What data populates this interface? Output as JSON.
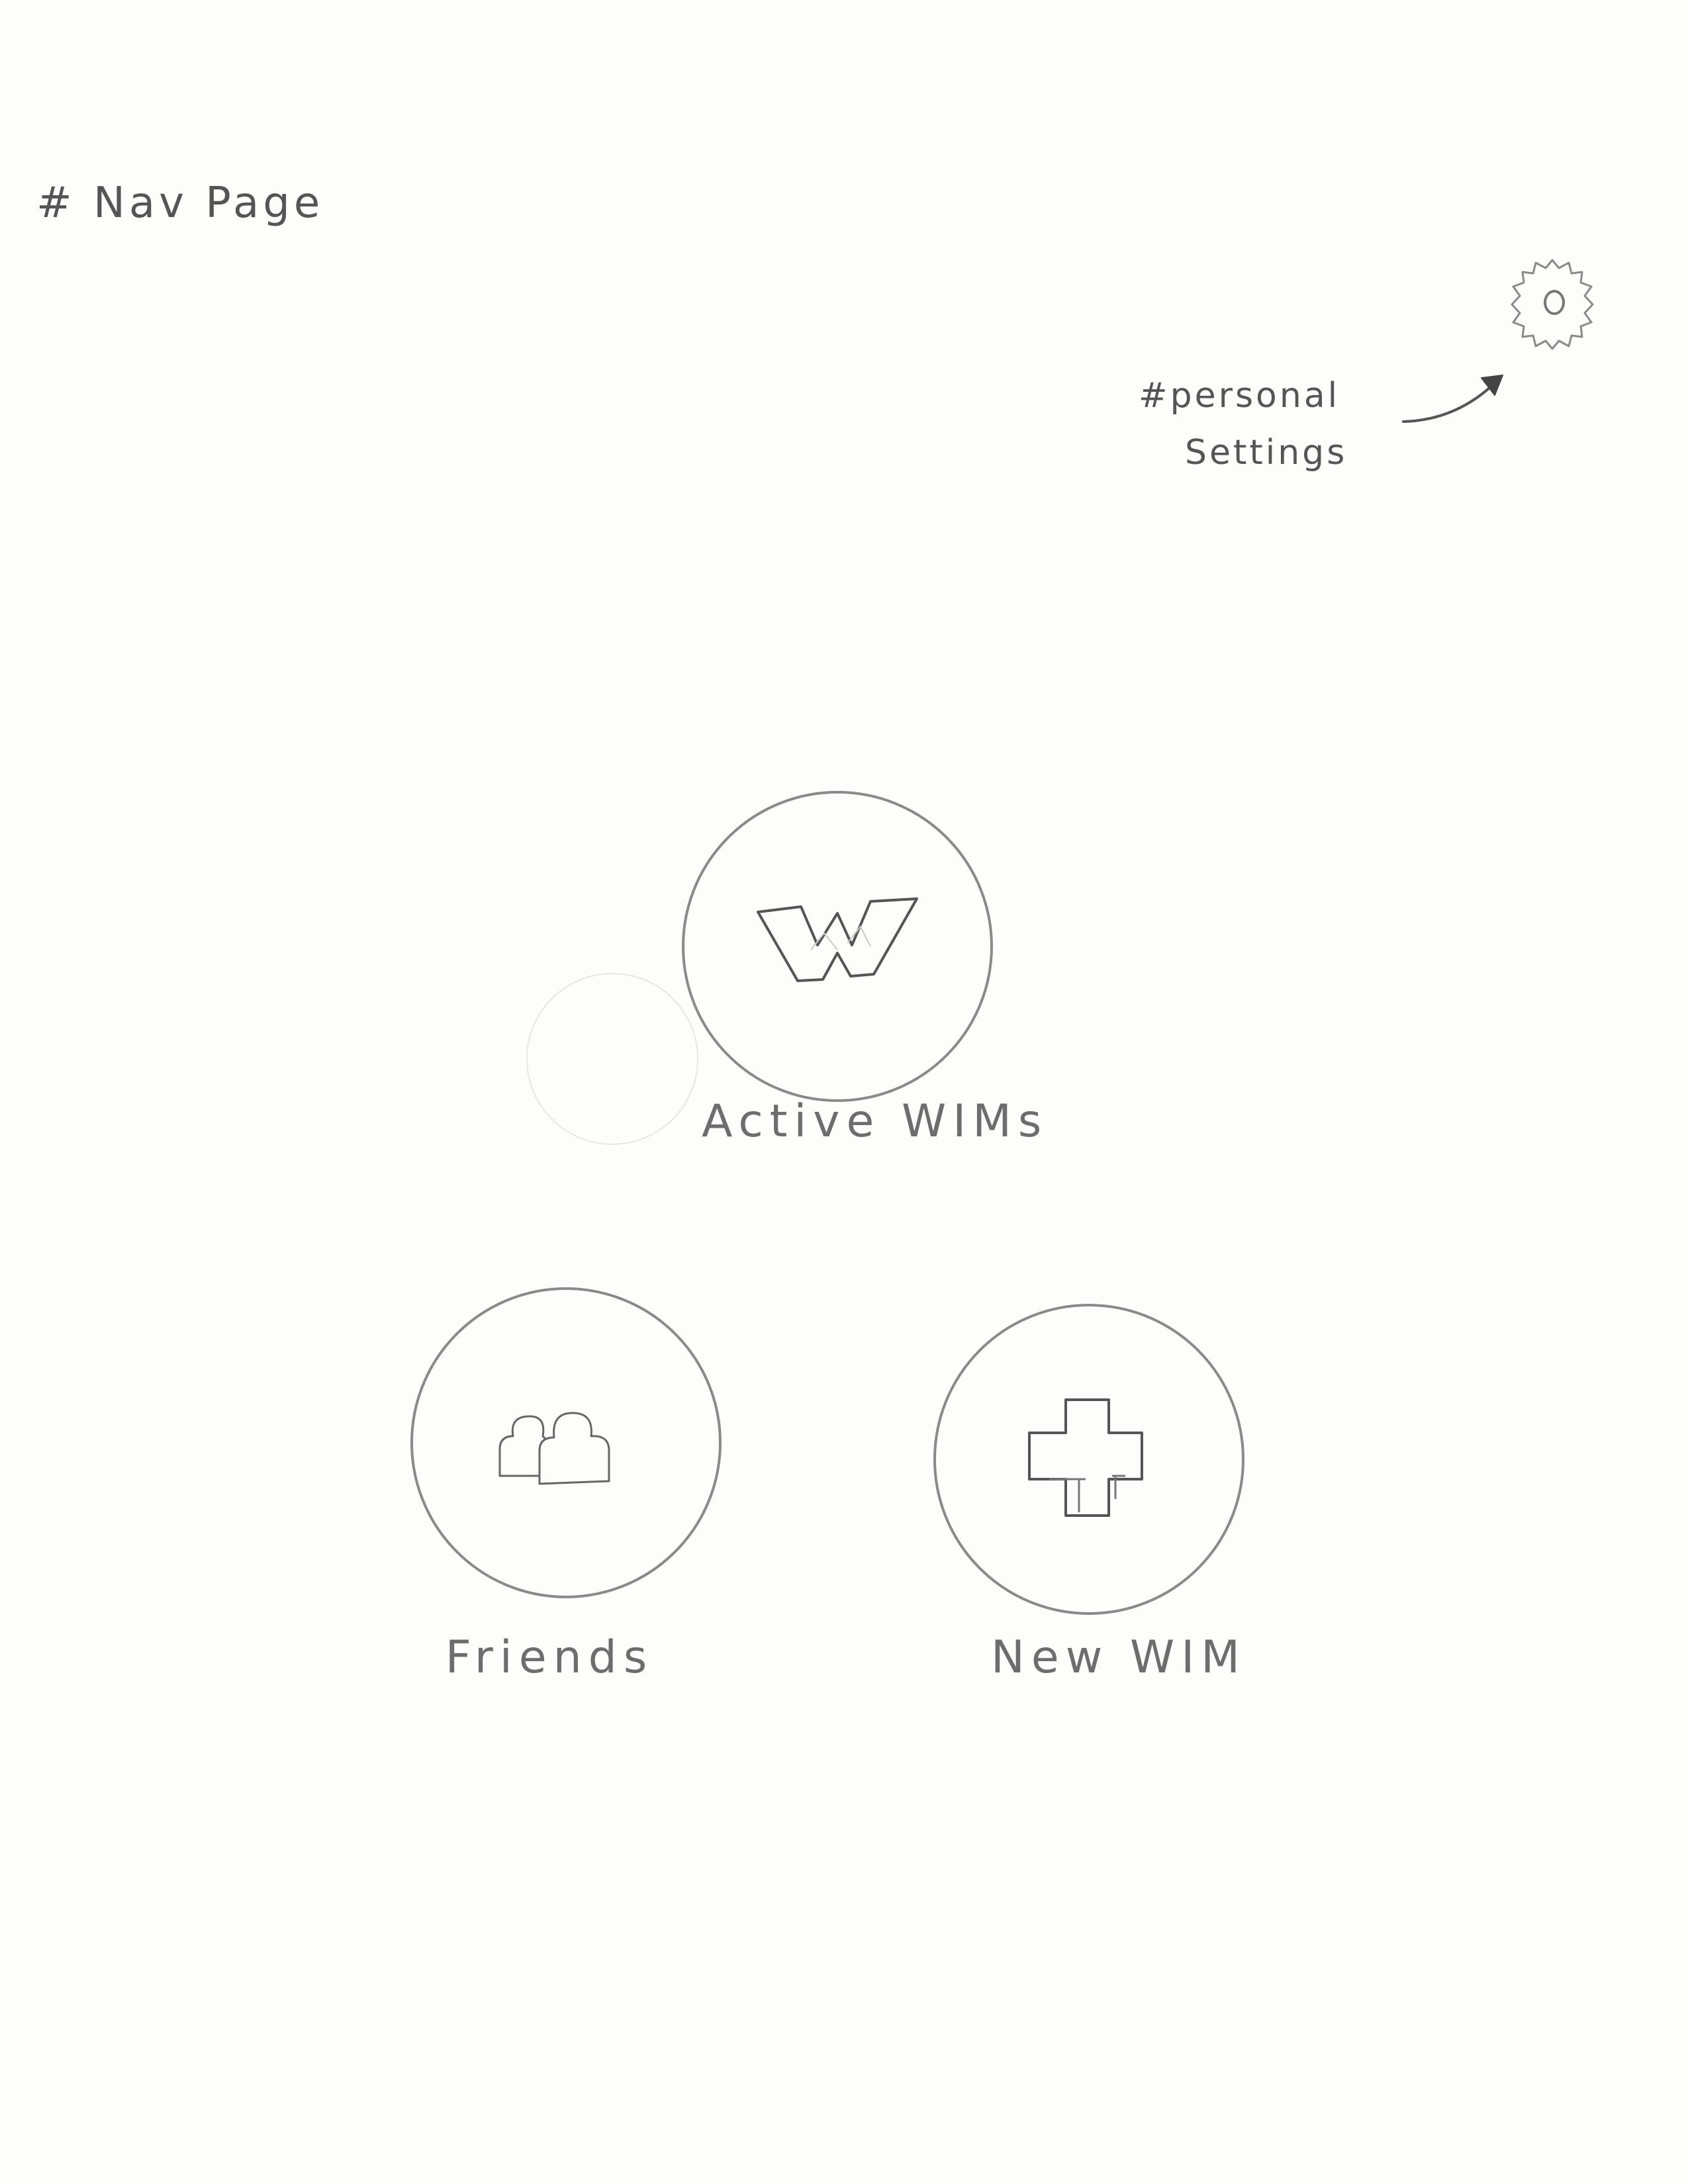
{
  "header": {
    "title": "# Nav Page"
  },
  "settings": {
    "icon": "gear-icon",
    "note_line1": "#personal",
    "note_line2": "Settings"
  },
  "nav": {
    "active_wims": {
      "label": "Active WIMs",
      "icon": "w-logo-icon"
    },
    "friends": {
      "label": "Friends",
      "icon": "friends-icon"
    },
    "new_wim": {
      "label": "New WIM",
      "icon": "plus-icon"
    }
  },
  "colors": {
    "stroke": "#8a8a8a",
    "text": "#6d6d6d",
    "paper": "#fdfdfc"
  }
}
